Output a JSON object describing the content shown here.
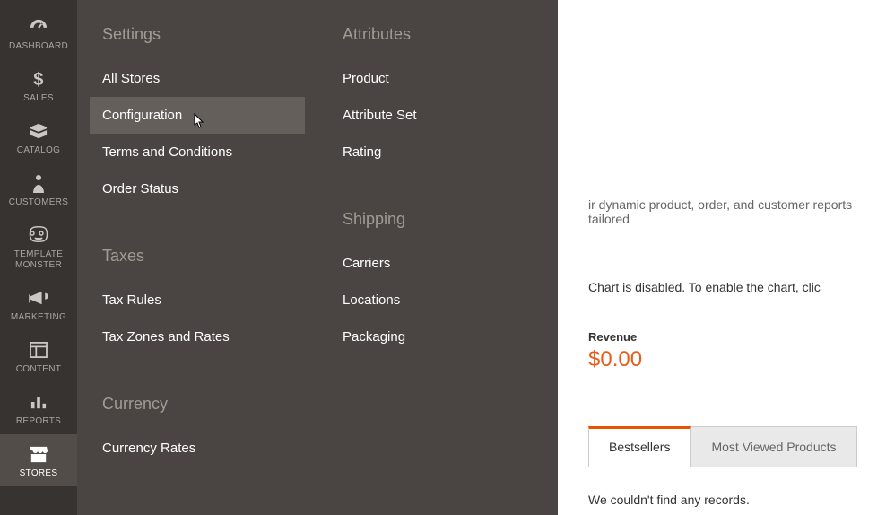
{
  "nav": [
    {
      "id": "dashboard",
      "label": "DASHBOARD"
    },
    {
      "id": "sales",
      "label": "SALES"
    },
    {
      "id": "catalog",
      "label": "CATALOG"
    },
    {
      "id": "customers",
      "label": "CUSTOMERS"
    },
    {
      "id": "template-monster",
      "label": "TEMPLATE MONSTER"
    },
    {
      "id": "marketing",
      "label": "MARKETING"
    },
    {
      "id": "content",
      "label": "CONTENT"
    },
    {
      "id": "reports",
      "label": "REPORTS"
    },
    {
      "id": "stores",
      "label": "STORES",
      "active": true
    }
  ],
  "flyout": {
    "col1": {
      "settings_heading": "Settings",
      "settings_items": [
        "All Stores",
        "Configuration",
        "Terms and Conditions",
        "Order Status"
      ],
      "settings_selected": "Configuration",
      "taxes_heading": "Taxes",
      "taxes_items": [
        "Tax Rules",
        "Tax Zones and Rates"
      ],
      "currency_heading": "Currency",
      "currency_items": [
        "Currency Rates"
      ]
    },
    "col2": {
      "attributes_heading": "Attributes",
      "attributes_items": [
        "Product",
        "Attribute Set",
        "Rating"
      ],
      "shipping_heading": "Shipping",
      "shipping_items": [
        "Carriers",
        "Locations",
        "Packaging"
      ]
    }
  },
  "main": {
    "hint_fragment": "ir dynamic product, order, and customer reports tailored",
    "chart_msg": "Chart is disabled. To enable the chart, clic",
    "revenue_label": "Revenue",
    "revenue_value": "$0.00",
    "tab_bestsellers": "Bestsellers",
    "tab_mostviewed": "Most Viewed Products",
    "empty": "We couldn't find any records."
  }
}
